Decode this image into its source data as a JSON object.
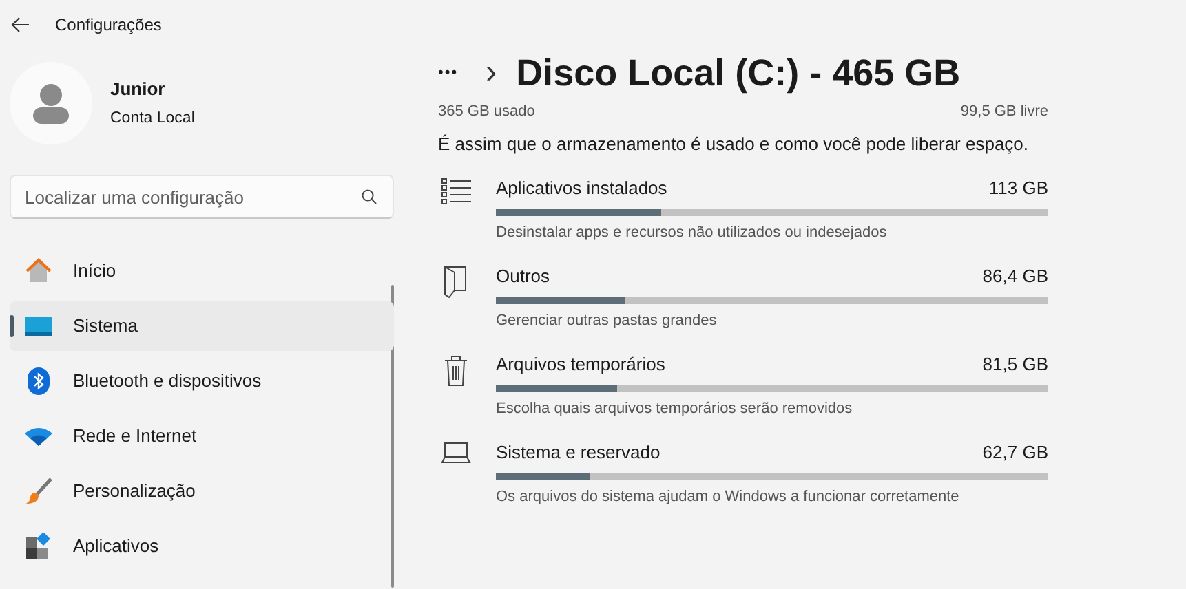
{
  "window": {
    "title": "Configurações"
  },
  "account": {
    "name": "Junior",
    "type": "Conta Local"
  },
  "search": {
    "placeholder": "Localizar uma configuração"
  },
  "sidebar": {
    "items": [
      {
        "label": "Início",
        "selected": false
      },
      {
        "label": "Sistema",
        "selected": true
      },
      {
        "label": "Bluetooth e dispositivos",
        "selected": false
      },
      {
        "label": "Rede e Internet",
        "selected": false
      },
      {
        "label": "Personalização",
        "selected": false
      },
      {
        "label": "Aplicativos",
        "selected": false
      }
    ]
  },
  "breadcrumb": {
    "more": "•••",
    "separator": "›",
    "title": "Disco Local (C:) - 465 GB"
  },
  "usage": {
    "used": "365 GB usado",
    "free": "99,5 GB livre"
  },
  "description": "É assim que o armazenamento é usado e como você pode liberar espaço.",
  "categories": [
    {
      "name": "Aplicativos instalados",
      "size": "113 GB",
      "level": 0.3,
      "hint": "Desinstalar apps e recursos não utilizados ou indesejados"
    },
    {
      "name": "Outros",
      "size": "86,4 GB",
      "level": 0.235,
      "hint": "Gerenciar outras pastas grandes"
    },
    {
      "name": "Arquivos temporários",
      "size": "81,5 GB",
      "level": 0.22,
      "hint": "Escolha quais arquivos temporários serão removidos"
    },
    {
      "name": "Sistema e reservado",
      "size": "62,7 GB",
      "level": 0.17,
      "hint": "Os arquivos do sistema ajudam o Windows a funcionar corretamente"
    }
  ]
}
